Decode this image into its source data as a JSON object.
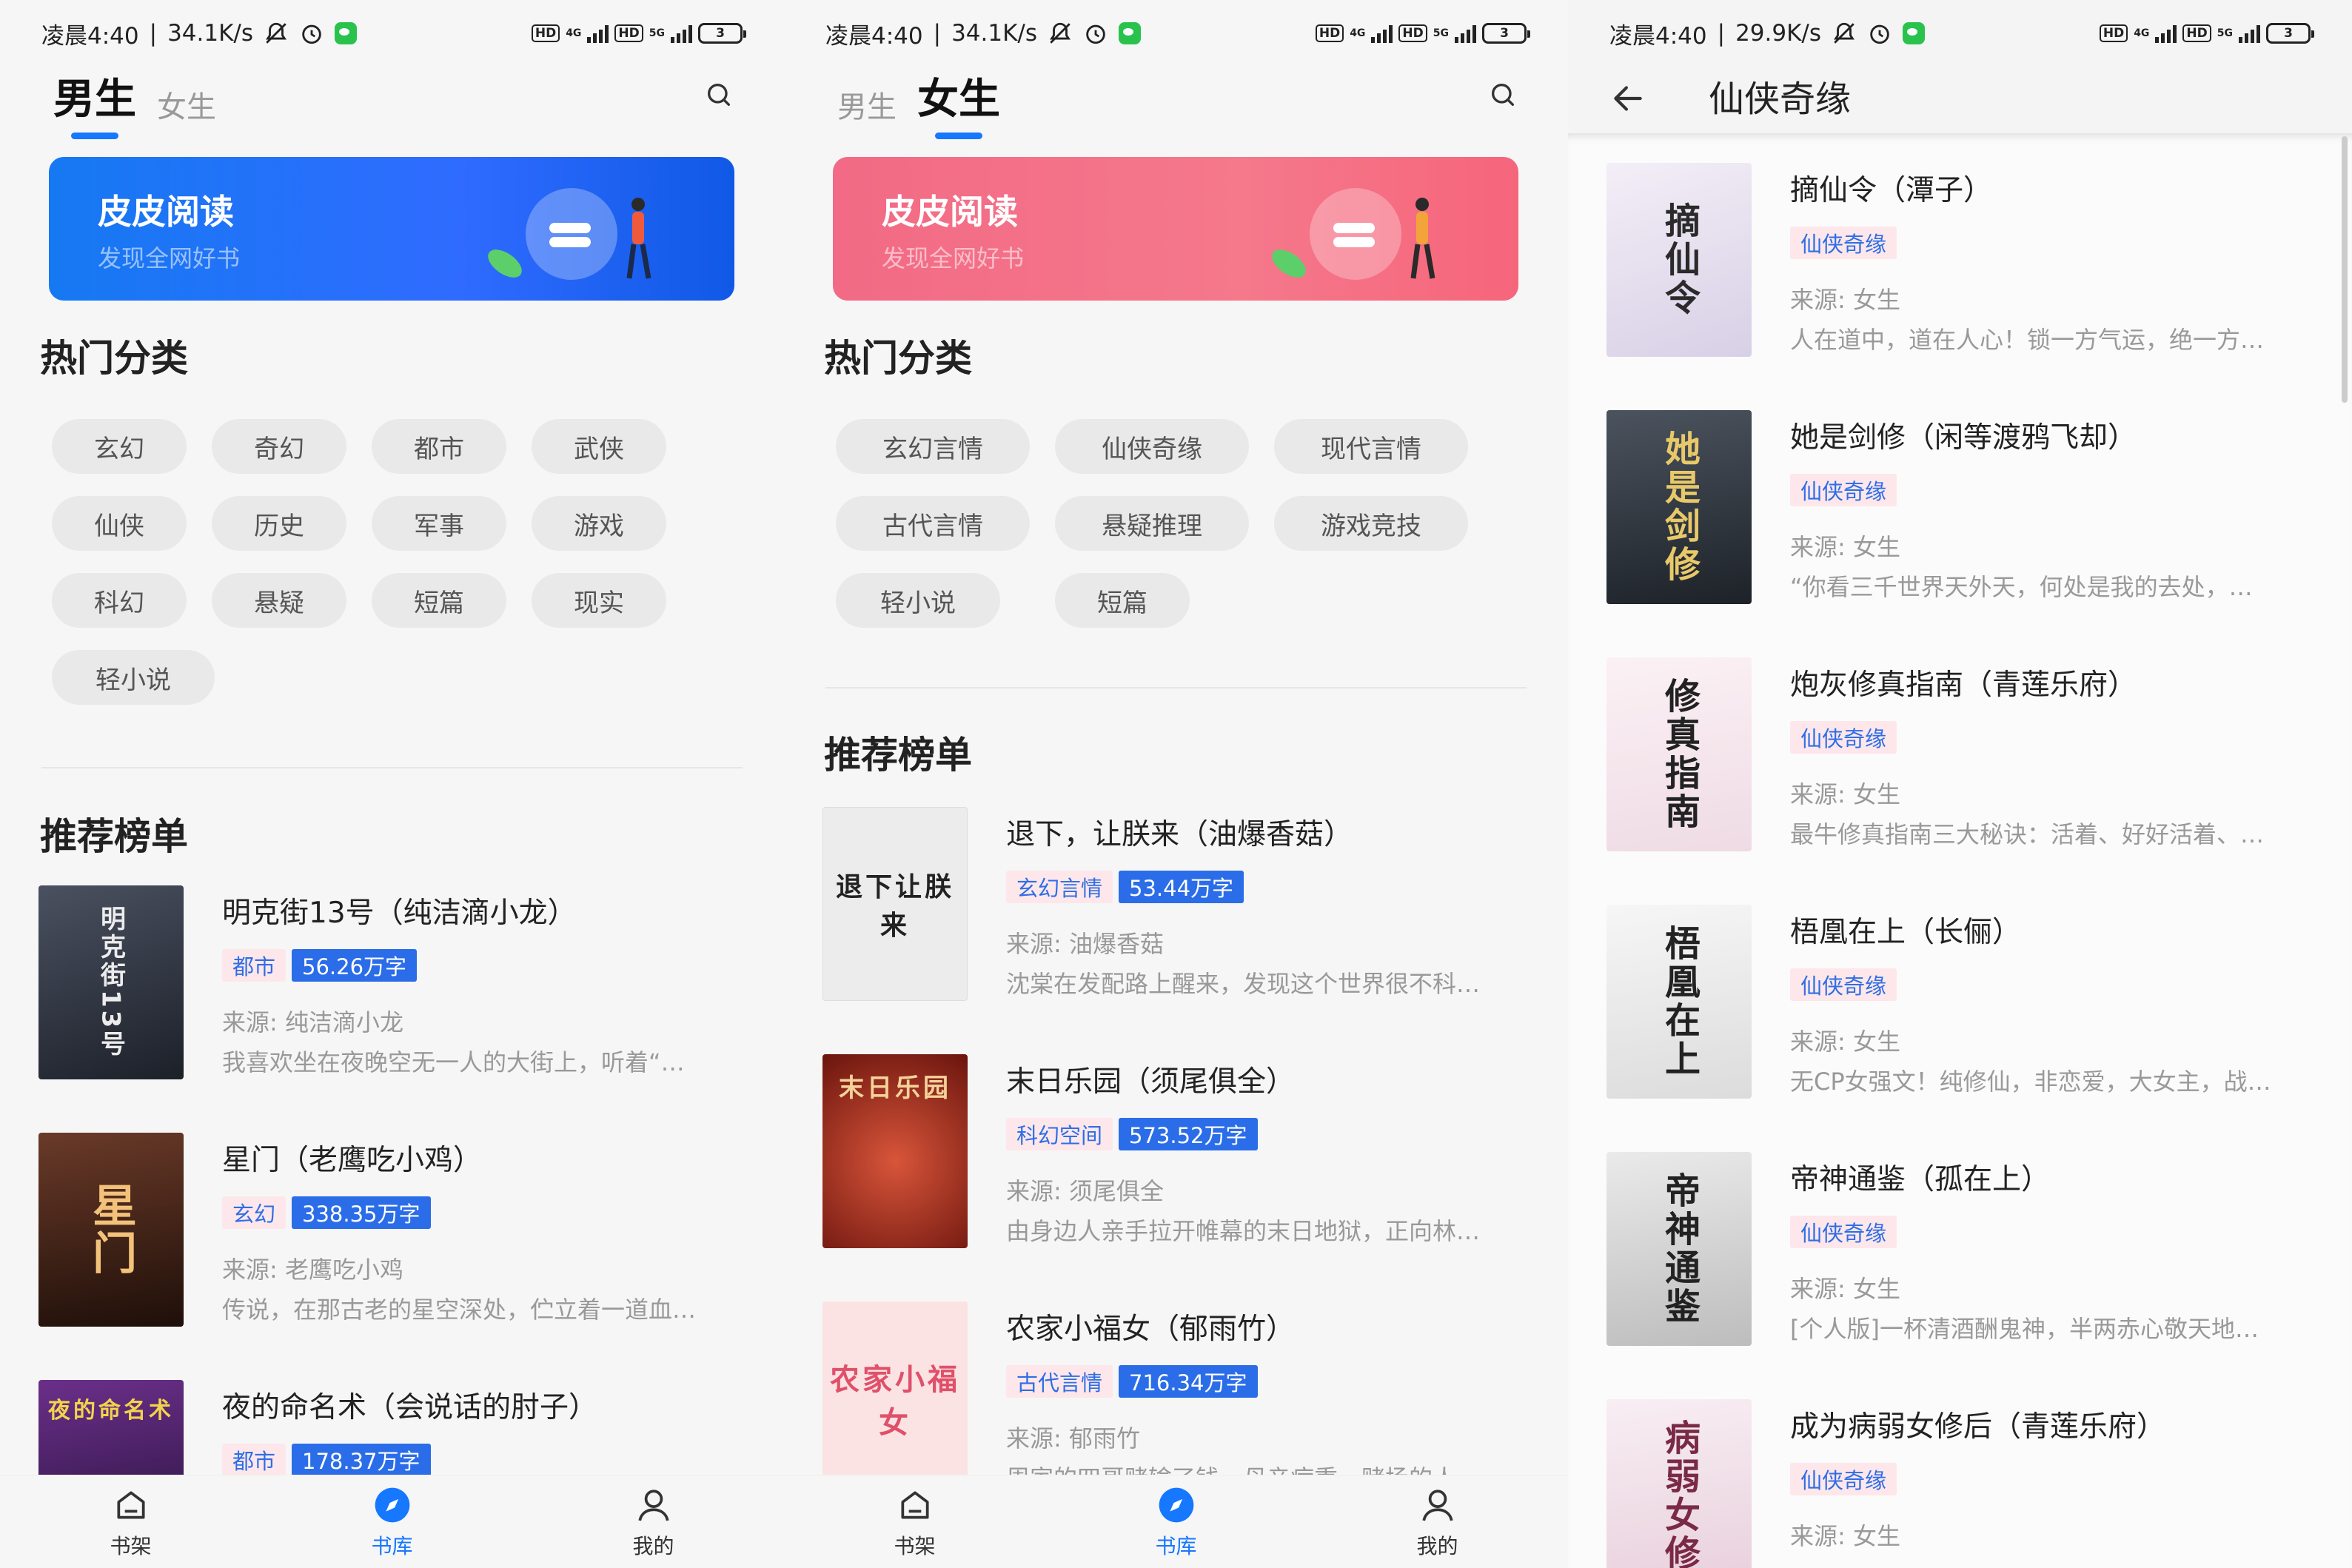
{
  "status": {
    "time": "凌晨4:40",
    "speed_1": "34.1K/s",
    "speed_2": "34.1K/s",
    "speed_3": "29.9K/s",
    "battery": "3",
    "net_4g": "4G",
    "net_5g": "5G",
    "hd": "HD"
  },
  "colors": {
    "accent": "#1677ff",
    "banner_blue": "#1a73f0",
    "banner_pink": "#f26d84",
    "tag_blue": "#2b6de8"
  },
  "screen1": {
    "tabs": [
      "男生",
      "女生"
    ],
    "active_tab": 0,
    "banner": {
      "title": "皮皮阅读",
      "subtitle": "发现全网好书"
    },
    "hot_title": "热门分类",
    "categories": [
      "玄幻",
      "奇幻",
      "都市",
      "武侠",
      "仙侠",
      "历史",
      "军事",
      "游戏",
      "科幻",
      "悬疑",
      "短篇",
      "现实",
      "轻小说"
    ],
    "rank_title": "推荐榜单",
    "books": [
      {
        "title": "明克街13号（纯洁滴小龙）",
        "category": "都市",
        "words": "56.26万字",
        "source": "来源: 纯洁滴小龙",
        "desc": "我喜欢坐在夜晚空无一人的大街上，听着“…",
        "cover_text": "明克街13号",
        "cover_bg": "#2a2f3a",
        "cover_fg": "#e8e8e8"
      },
      {
        "title": "星门（老鹰吃小鸡）",
        "category": "玄幻",
        "words": "338.35万字",
        "source": "来源: 老鹰吃小鸡",
        "desc": "传说，在那古老的星空深处，伫立着一道血…",
        "cover_text": "星门",
        "cover_bg": "#3a1e14",
        "cover_fg": "#f3c27a"
      },
      {
        "title": "夜的命名术（会说话的肘子）",
        "category": "都市",
        "words": "178.37万字",
        "source": "",
        "desc": "",
        "cover_text": "夜的命名术",
        "cover_bg": "#3a1f55",
        "cover_fg": "#f2d34c"
      }
    ]
  },
  "screen2": {
    "tabs": [
      "男生",
      "女生"
    ],
    "active_tab": 1,
    "banner": {
      "title": "皮皮阅读",
      "subtitle": "发现全网好书"
    },
    "hot_title": "热门分类",
    "categories": [
      "玄幻言情",
      "仙侠奇缘",
      "现代言情",
      "古代言情",
      "悬疑推理",
      "游戏竞技",
      "轻小说",
      "短篇"
    ],
    "rank_title": "推荐榜单",
    "books": [
      {
        "title": "退下，让朕来（油爆香菇）",
        "category": "玄幻言情",
        "words": "53.44万字",
        "source": "来源: 油爆香菇",
        "desc": "沈棠在发配路上醒来，发现这个世界很不科…",
        "cover_text": "退下让朕来",
        "cover_bg": "#ececec",
        "cover_fg": "#222222"
      },
      {
        "title": "末日乐园（须尾俱全）",
        "category": "科幻空间",
        "words": "573.52万字",
        "source": "来源: 须尾俱全",
        "desc": "由身边人亲手拉开帷幕的末日地狱，正向林…",
        "cover_text": "末日乐园",
        "cover_bg": "#8a1f15",
        "cover_fg": "#f4d29a"
      },
      {
        "title": "农家小福女（郁雨竹）",
        "category": "古代言情",
        "words": "716.34万字",
        "source": "来源: 郁雨竹",
        "desc": "周家的四哥赌输了钱，母亲病重，赌场的人…",
        "cover_text": "农家小福女",
        "cover_bg": "#fbe3e3",
        "cover_fg": "#e0506a"
      }
    ]
  },
  "screen3": {
    "title": "仙侠奇缘",
    "books": [
      {
        "title": "摘仙令（潭子）",
        "category": "仙侠奇缘",
        "source": "来源: 女生",
        "desc": "人在道中，道在人心！锁一方气运，绝一方…",
        "cover_text": "摘仙令",
        "cover_bg": "#efe9f3",
        "cover_fg": "#2a2a2a"
      },
      {
        "title": "她是剑修（闲等渡鸦飞却）",
        "category": "仙侠奇缘",
        "source": "来源: 女生",
        "desc": "“你看三千世界天外天，何处是我的去处，…",
        "cover_text": "她是剑修",
        "cover_bg": "#2e343c",
        "cover_fg": "#e8c96a"
      },
      {
        "title": "炮灰修真指南（青莲乐府）",
        "category": "仙侠奇缘",
        "source": "来源: 女生",
        "desc": "最牛修真指南三大秘诀：活着、好好活着、…",
        "cover_text": "修真指南",
        "cover_bg": "#f7eef2",
        "cover_fg": "#222222"
      },
      {
        "title": "梧凰在上（长俪）",
        "category": "仙侠奇缘",
        "source": "来源: 女生",
        "desc": "无CP女强文！纯修仙，非恋爱，大女主，战…",
        "cover_text": "梧凰在上",
        "cover_bg": "#f1f1f1",
        "cover_fg": "#222222"
      },
      {
        "title": "帝神通鉴（孤在上）",
        "category": "仙侠奇缘",
        "source": "来源: 女生",
        "desc": "[个人版]一杯清酒酬鬼神，半两赤心敬天地…",
        "cover_text": "帝神通鉴",
        "cover_bg": "#e2e2e2",
        "cover_fg": "#222222"
      },
      {
        "title": "成为病弱女修后（青莲乐府）",
        "category": "仙侠奇缘",
        "source": "来源: 女生",
        "desc": "",
        "cover_text": "病弱女修",
        "cover_bg": "#f5e9ef",
        "cover_fg": "#7a2a45"
      }
    ]
  },
  "nav": {
    "items": [
      "书架",
      "书库",
      "我的"
    ],
    "active": 1
  }
}
